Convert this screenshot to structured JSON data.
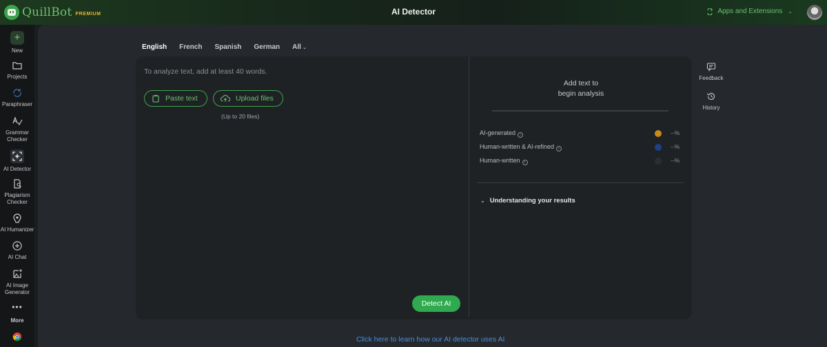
{
  "header": {
    "logo_name": "QuillBot",
    "logo_badge": "PREMIUM",
    "title": "AI Detector",
    "apps_label": "Apps and Extensions",
    "brand_color": "#6cc070",
    "premium_color": "#f0b429"
  },
  "sidebar": {
    "items": [
      {
        "label": "New",
        "icon": "plus-icon"
      },
      {
        "label": "Projects",
        "icon": "folder-icon"
      },
      {
        "label": "Paraphraser",
        "icon": "paraphraser-icon"
      },
      {
        "label": "Grammar Checker",
        "icon": "grammar-icon"
      },
      {
        "label": "AI Detector",
        "icon": "ai-detector-icon",
        "active": true
      },
      {
        "label": "Plagiarism Checker",
        "icon": "plagiarism-icon"
      },
      {
        "label": "AI Humanizer",
        "icon": "humanizer-icon"
      },
      {
        "label": "AI Chat",
        "icon": "chat-icon"
      },
      {
        "label": "AI Image Generator",
        "icon": "image-generator-icon"
      },
      {
        "label": "More",
        "icon": "more-icon"
      }
    ]
  },
  "languages": {
    "tabs": [
      "English",
      "French",
      "Spanish",
      "German",
      "All"
    ],
    "active": "English"
  },
  "editor": {
    "placeholder": "To analyze text, add at least 40 words.",
    "paste_label": "Paste text",
    "upload_label": "Upload files",
    "upload_note": "(Up to 20 files)",
    "detect_label": "Detect AI",
    "detect_color": "#2faa4f"
  },
  "analysis": {
    "empty_line1": "Add text to",
    "empty_line2": "begin analysis",
    "scores": [
      {
        "label": "AI-generated",
        "value": "--%",
        "color": "#c98a1a"
      },
      {
        "label": "Human-written & AI-refined",
        "value": "--%",
        "color": "#1e3f8a"
      },
      {
        "label": "Human-written",
        "value": "--%",
        "color": "#2a2e32"
      }
    ],
    "understanding": "Understanding your results"
  },
  "right_tools": [
    {
      "label": "Feedback",
      "icon": "feedback-icon"
    },
    {
      "label": "History",
      "icon": "history-icon"
    }
  ],
  "footer": {
    "learn_link": "Click here to learn how our AI detector uses AI",
    "link_color": "#4a90e2"
  }
}
